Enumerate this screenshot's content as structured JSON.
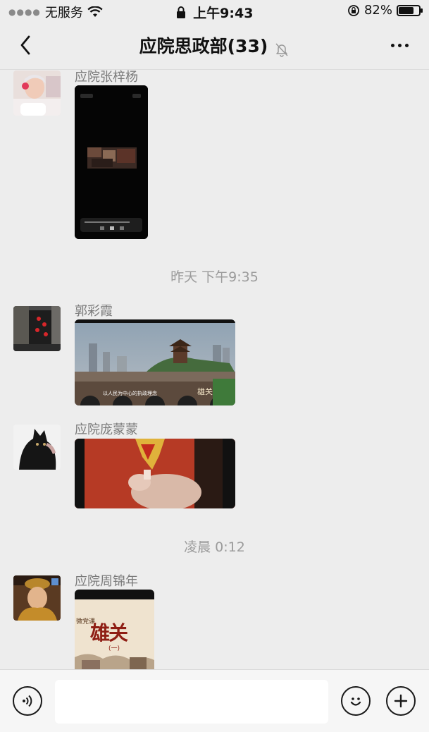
{
  "status_bar": {
    "carrier": "无服务",
    "time": "上午9:43",
    "battery_percent": "82%",
    "battery_level": 0.82
  },
  "nav": {
    "title": "应院思政部(33)"
  },
  "messages": [
    {
      "sender": "应院张梓杨"
    },
    {
      "sender": "郭彩霞",
      "video_caption": "以人民为中心的执政理念",
      "video_watermark": "雄关"
    },
    {
      "sender": "应院庞蒙蒙"
    },
    {
      "sender": "应院周锦年",
      "poster_title": "雄关",
      "poster_sub": "(一)",
      "poster_side": "微党课"
    }
  ],
  "timestamps": [
    "昨天 下午9:35",
    "凌晨 0:12"
  ],
  "input": {
    "placeholder": ""
  }
}
